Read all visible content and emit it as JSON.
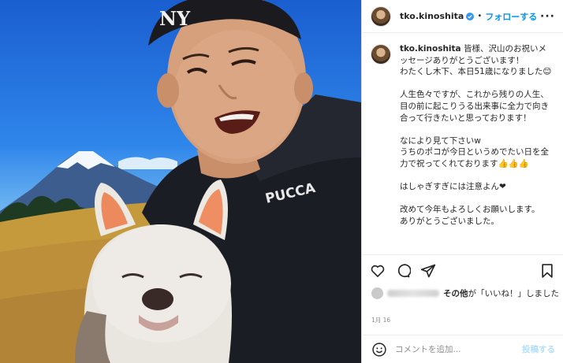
{
  "post": {
    "username": "tko.kinoshita",
    "follow_label": "フォローする",
    "separator": "•",
    "more_label": "···",
    "caption_lead": "皆様、沢山のお祝いメッセージありがとうございます！",
    "caption_body": "\nわたくし木下、本日51歳になりました😊\n\n人生色々ですが、これから残りの人生、目の前に起こりうる出来事に全力で向き合って行きたいと思っております！\n\nなにより見て下さいw\nうちのポコが今日というめでたい日を全力で祝ってくれております👍👍👍\n\nはしゃぎすぎには注意よん❤\n\n改めて今年もよろしくお願いします。\nありがとうございました。",
    "likes_text_bold": "その他",
    "likes_text": "が「いいね！」しました",
    "date": "1月 16",
    "comment_placeholder": "コメントを追加...",
    "post_label": "投稿する"
  },
  "photo": {
    "cap_logo": "NY",
    "jacket_brand": "PUCCA"
  },
  "icons": {
    "header": [
      "avatar",
      "verified-icon",
      "more-icon"
    ],
    "actions": [
      "heart-icon",
      "comment-icon",
      "share-icon",
      "bookmark-icon"
    ],
    "comment": [
      "emoji-icon"
    ]
  },
  "colors": {
    "accent": "#0095f6",
    "post_disabled": "#b2dffc",
    "muted": "#8e8e8e"
  }
}
